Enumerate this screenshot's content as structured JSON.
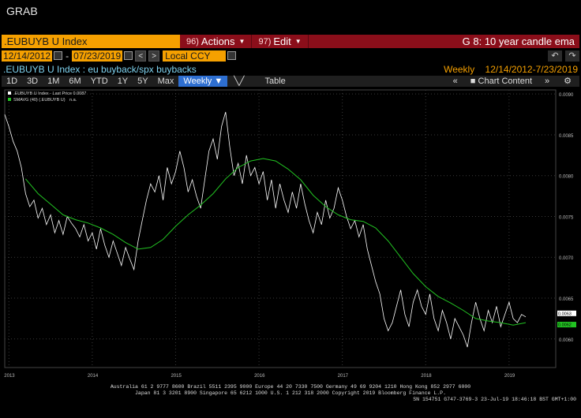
{
  "window": {
    "title": "GRAB"
  },
  "command_bar": {
    "ticker": ".EUBUYB U Index",
    "actions": {
      "num": "96)",
      "label": "Actions"
    },
    "edit": {
      "num": "97)",
      "label": "Edit"
    },
    "graph_title": "G 8: 10 year candle ema"
  },
  "date_range": {
    "start": "12/14/2012",
    "separator": "-",
    "end": "07/23/2019",
    "currency": "Local CCY",
    "prev": "<",
    "next": ">",
    "undo": "↶",
    "redo": "↷"
  },
  "subtitle": {
    "description": ".EUBUYB U Index : eu buyback/spx buybacks",
    "frequency": "Weekly",
    "period": "12/14/2012-7/23/2019"
  },
  "toolbar": {
    "tabs": [
      "1D",
      "3D",
      "1M",
      "6M",
      "YTD",
      "1Y",
      "5Y",
      "Max"
    ],
    "active": "Weekly",
    "active_caret": "▼",
    "chart_icon": "╲╱",
    "table_label": "Table",
    "collapse": "«",
    "chart_content_label": "Chart Content",
    "expand": "»",
    "gear": "⚙"
  },
  "chart_data": {
    "type": "line",
    "legend": [
      {
        "name": ".EUBUYB U Index - Last Price 0.0087",
        "color": "#ffffff"
      },
      {
        "name": "SMAVG (40) (.EUBUYB U)",
        "value": "n.a.",
        "color": "#22c322"
      }
    ],
    "y_ticks": [
      "0.0090",
      "0.0085",
      "0.0080",
      "0.0075",
      "0.0070",
      "0.0065",
      "0.0060"
    ],
    "ylim": [
      0.00565,
      0.00905
    ],
    "x_ticks": [
      "2013",
      "2014",
      "2015",
      "2016",
      "2017",
      "2018",
      "2019"
    ],
    "xlim": [
      2012.95,
      2019.56
    ],
    "last_labels": {
      "price": "0.0063",
      "smavg": "0.0062"
    },
    "series": [
      {
        "name": "Last Price",
        "color": "#ffffff",
        "x": [
          2012.95,
          2013.0,
          2013.05,
          2013.1,
          2013.15,
          2013.2,
          2013.25,
          2013.3,
          2013.35,
          2013.4,
          2013.45,
          2013.5,
          2013.55,
          2013.6,
          2013.65,
          2013.7,
          2013.75,
          2013.8,
          2013.85,
          2013.9,
          2013.95,
          2014.0,
          2014.05,
          2014.1,
          2014.15,
          2014.2,
          2014.25,
          2014.3,
          2014.35,
          2014.4,
          2014.45,
          2014.5,
          2014.55,
          2014.6,
          2014.65,
          2014.7,
          2014.75,
          2014.8,
          2014.85,
          2014.9,
          2014.95,
          2015.0,
          2015.05,
          2015.1,
          2015.15,
          2015.2,
          2015.25,
          2015.3,
          2015.35,
          2015.4,
          2015.45,
          2015.5,
          2015.55,
          2015.6,
          2015.65,
          2015.7,
          2015.75,
          2015.8,
          2015.85,
          2015.9,
          2015.95,
          2016.0,
          2016.05,
          2016.1,
          2016.15,
          2016.2,
          2016.25,
          2016.3,
          2016.35,
          2016.4,
          2016.45,
          2016.5,
          2016.55,
          2016.6,
          2016.65,
          2016.7,
          2016.75,
          2016.8,
          2016.85,
          2016.9,
          2016.95,
          2017.0,
          2017.05,
          2017.1,
          2017.15,
          2017.2,
          2017.25,
          2017.3,
          2017.35,
          2017.4,
          2017.45,
          2017.5,
          2017.55,
          2017.6,
          2017.65,
          2017.7,
          2017.75,
          2017.8,
          2017.85,
          2017.9,
          2017.95,
          2018.0,
          2018.05,
          2018.1,
          2018.15,
          2018.2,
          2018.25,
          2018.3,
          2018.35,
          2018.4,
          2018.45,
          2018.5,
          2018.55,
          2018.6,
          2018.65,
          2018.7,
          2018.75,
          2018.8,
          2018.85,
          2018.9,
          2018.95,
          2019.0,
          2019.05,
          2019.1,
          2019.15,
          2019.2
        ],
        "y": [
          0.00875,
          0.0086,
          0.00842,
          0.0083,
          0.0081,
          0.00778,
          0.00762,
          0.0077,
          0.00748,
          0.0076,
          0.0074,
          0.00752,
          0.0073,
          0.00745,
          0.00728,
          0.0075,
          0.00742,
          0.00735,
          0.00725,
          0.0074,
          0.0072,
          0.0073,
          0.0071,
          0.00735,
          0.00715,
          0.007,
          0.0072,
          0.00705,
          0.0069,
          0.00712,
          0.00698,
          0.00685,
          0.0072,
          0.00745,
          0.0077,
          0.0079,
          0.0078,
          0.008,
          0.0077,
          0.0081,
          0.0079,
          0.00805,
          0.0083,
          0.0081,
          0.0078,
          0.00795,
          0.00775,
          0.0076,
          0.00795,
          0.0083,
          0.00845,
          0.0082,
          0.0086,
          0.00878,
          0.00835,
          0.008,
          0.00815,
          0.0079,
          0.00825,
          0.008,
          0.0081,
          0.0079,
          0.00805,
          0.0077,
          0.00795,
          0.0076,
          0.0079,
          0.0077,
          0.00755,
          0.0078,
          0.0076,
          0.0079,
          0.00765,
          0.00745,
          0.0073,
          0.00755,
          0.0074,
          0.0077,
          0.00748,
          0.0076,
          0.00785,
          0.0077,
          0.0075,
          0.00735,
          0.00745,
          0.00725,
          0.0074,
          0.0071,
          0.0069,
          0.0067,
          0.00655,
          0.00625,
          0.0061,
          0.0062,
          0.0064,
          0.0066,
          0.0063,
          0.00615,
          0.00645,
          0.0066,
          0.0064,
          0.0063,
          0.00655,
          0.00625,
          0.0061,
          0.00635,
          0.0062,
          0.006,
          0.00625,
          0.00615,
          0.00605,
          0.0059,
          0.0062,
          0.00645,
          0.00625,
          0.0061,
          0.00635,
          0.0062,
          0.0064,
          0.00615,
          0.0063,
          0.00645,
          0.00625,
          0.0062,
          0.0063,
          0.00627
        ]
      },
      {
        "name": "SMAVG (40)",
        "color": "#22c322",
        "x": [
          2013.2,
          2013.35,
          2013.5,
          2013.65,
          2013.8,
          2013.95,
          2014.1,
          2014.25,
          2014.4,
          2014.55,
          2014.7,
          2014.85,
          2015.0,
          2015.15,
          2015.3,
          2015.45,
          2015.6,
          2015.75,
          2015.9,
          2016.05,
          2016.2,
          2016.35,
          2016.5,
          2016.65,
          2016.8,
          2016.95,
          2017.1,
          2017.25,
          2017.4,
          2017.55,
          2017.7,
          2017.85,
          2018.0,
          2018.15,
          2018.3,
          2018.45,
          2018.6,
          2018.75,
          2018.9,
          2019.05,
          2019.2
        ],
        "y": [
          0.00796,
          0.00778,
          0.00765,
          0.00752,
          0.00746,
          0.00742,
          0.00736,
          0.00728,
          0.00718,
          0.0071,
          0.00712,
          0.00722,
          0.00738,
          0.00752,
          0.00764,
          0.00778,
          0.00796,
          0.0081,
          0.00818,
          0.00821,
          0.00818,
          0.00808,
          0.00795,
          0.00776,
          0.00762,
          0.00752,
          0.00746,
          0.00744,
          0.00736,
          0.0072,
          0.007,
          0.0068,
          0.00664,
          0.00652,
          0.00644,
          0.00635,
          0.00625,
          0.00622,
          0.0062,
          0.00617,
          0.0062
        ]
      }
    ]
  },
  "footer": {
    "line1": "Australia 61 2 9777 8600 Brazil 5511 2395 9000 Europe 44 20 7330 7500 Germany 49 69 9204 1210 Hong Kong 852 2977 6000",
    "line2": "Japan 81 3 3201 8900        Singapore 65 6212 1000        U.S. 1 212 318 2000        Copyright 2019 Bloomberg Finance L.P.",
    "line3": "SN 154751 G747-3769-3 23-Jul-19 18:46:18 BST  GMT+1:00"
  }
}
